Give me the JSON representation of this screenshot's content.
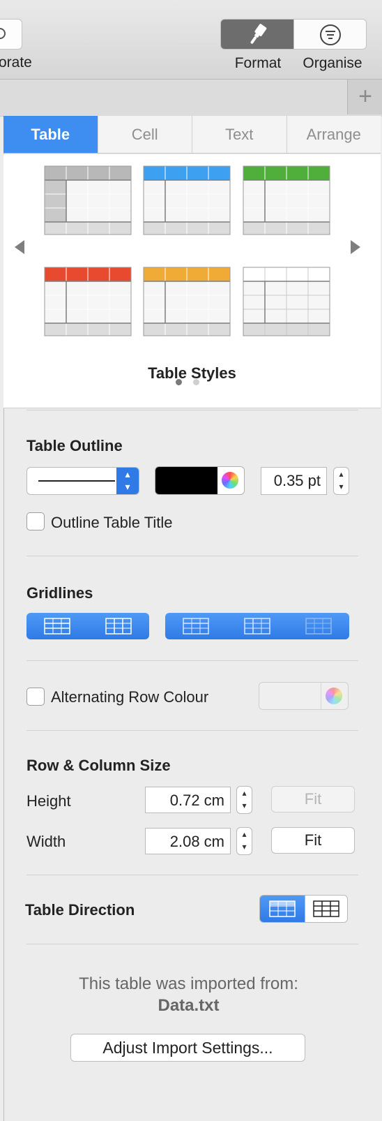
{
  "toolbar": {
    "collaborate_label": "orate",
    "format_label": "Format",
    "organise_label": "Organise",
    "add_sheet_symbol": "+"
  },
  "inspector_tabs": [
    "Table",
    "Cell",
    "Text",
    "Arrange"
  ],
  "table_styles": {
    "title": "Table Styles",
    "header_colors": [
      "#b8b8b8",
      "#3da0f0",
      "#4faf3a",
      "#e84a2f",
      "#efab36",
      "#ffffff"
    ],
    "page_count": 2,
    "current_page": 1
  },
  "table_outline": {
    "heading": "Table Outline",
    "stroke_color": "#000000",
    "width_value": "0.35 pt",
    "outline_title_label": "Outline Table Title",
    "outline_title_checked": false
  },
  "gridlines": {
    "heading": "Gridlines"
  },
  "alternating": {
    "label": "Alternating Row Colour",
    "checked": false
  },
  "row_column_size": {
    "heading": "Row & Column Size",
    "height_label": "Height",
    "height_value": "0.72 cm",
    "width_label": "Width",
    "width_value": "2.08 cm",
    "fit_label": "Fit"
  },
  "table_direction": {
    "heading": "Table Direction"
  },
  "import_info": {
    "text": "This table was imported from:",
    "filename": "Data.txt",
    "button_label": "Adjust Import Settings..."
  }
}
